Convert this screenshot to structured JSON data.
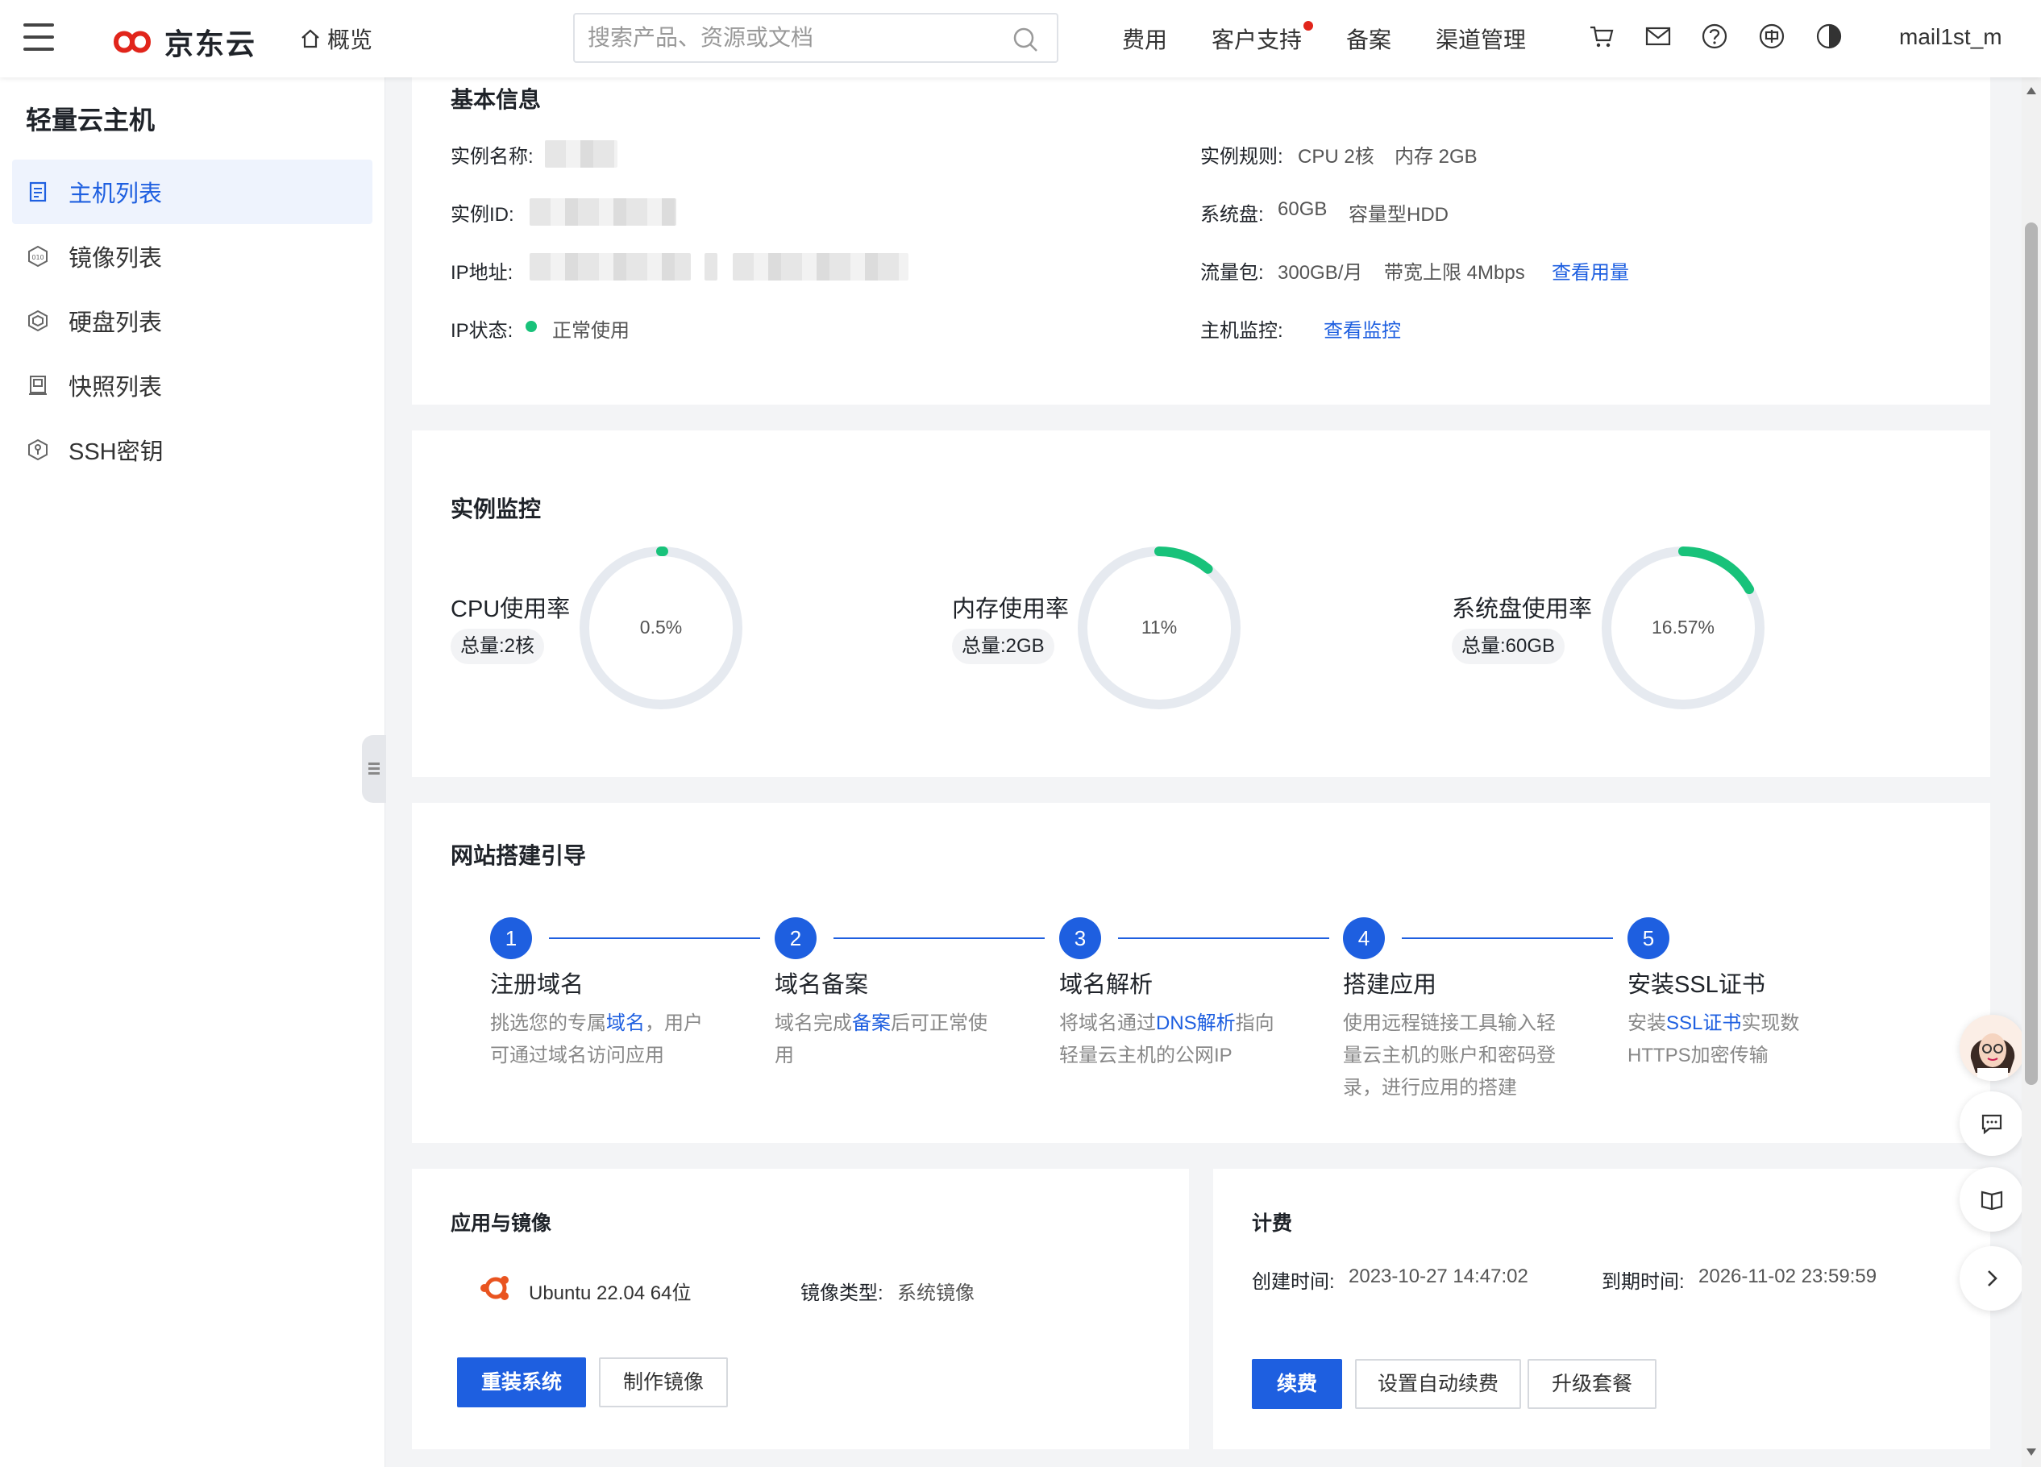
{
  "header": {
    "logo_text": "京东云",
    "overview": "概览",
    "search_placeholder": "搜索产品、资源或文档",
    "nav": [
      "费用",
      "客户支持",
      "备案",
      "渠道管理"
    ],
    "user": "mail1st_m"
  },
  "sidebar": {
    "title": "轻量云主机",
    "items": [
      {
        "label": "主机列表",
        "icon": "host-list-icon",
        "active": true
      },
      {
        "label": "镜像列表",
        "icon": "image-icon"
      },
      {
        "label": "硬盘列表",
        "icon": "disk-icon"
      },
      {
        "label": "快照列表",
        "icon": "snapshot-icon"
      },
      {
        "label": "SSH密钥",
        "icon": "key-icon"
      }
    ]
  },
  "basic_info": {
    "title": "基本信息",
    "instance_name_label": "实例名称:",
    "instance_id_label": "实例ID:",
    "ip_label": "IP地址:",
    "ip_status_label": "IP状态:",
    "ip_status_value": "正常使用",
    "spec_label": "实例规则:",
    "spec_cpu": "CPU 2核",
    "spec_mem": "内存 2GB",
    "sysdisk_label": "系统盘:",
    "sysdisk_size": "60GB",
    "sysdisk_type": "容量型HDD",
    "traffic_label": "流量包:",
    "traffic_value": "300GB/月",
    "bandwidth": "带宽上限 4Mbps",
    "traffic_link": "查看用量",
    "monitor_label": "主机监控:",
    "monitor_link": "查看监控"
  },
  "monitoring": {
    "title": "实例监控",
    "gauges": [
      {
        "label": "CPU使用率",
        "total": "总量:2核",
        "percent_text": "0.5%",
        "percent": 0.5
      },
      {
        "label": "内存使用率",
        "total": "总量:2GB",
        "percent_text": "11%",
        "percent": 11
      },
      {
        "label": "系统盘使用率",
        "total": "总量:60GB",
        "percent_text": "16.57%",
        "percent": 16.57
      }
    ],
    "colors": {
      "track": "#e6eaf0",
      "fill": "#18c27a"
    }
  },
  "guide": {
    "title": "网站搭建引导",
    "steps": [
      {
        "num": "1",
        "title": "注册域名",
        "desc_pre": "挑选您的专属",
        "desc_hl": "域名",
        "desc_post": "，用户可通过域名访问应用"
      },
      {
        "num": "2",
        "title": "域名备案",
        "desc_pre": "域名完成",
        "desc_hl": "备案",
        "desc_post": "后可正常使用"
      },
      {
        "num": "3",
        "title": "域名解析",
        "desc_pre": "将域名通过",
        "desc_hl": "DNS解析",
        "desc_post": "指向轻量云主机的公网IP"
      },
      {
        "num": "4",
        "title": "搭建应用",
        "desc_pre": "使用远程链接工具输入轻量云主机的账户和密码登录，进行应用的搭建",
        "desc_hl": "",
        "desc_post": ""
      },
      {
        "num": "5",
        "title": "安装SSL证书",
        "desc_pre": "安装",
        "desc_hl": "SSL证书",
        "desc_post": "实现数HTTPS加密传输"
      }
    ]
  },
  "app_image": {
    "title": "应用与镜像",
    "os": "Ubuntu 22.04 64位",
    "image_type_label": "镜像类型:",
    "image_type_value": "系统镜像",
    "btn_reinstall": "重装系统",
    "btn_make_image": "制作镜像"
  },
  "billing": {
    "title": "计费",
    "created_label": "创建时间:",
    "created_value": "2023-10-27 14:47:02",
    "expire_label": "到期时间:",
    "expire_value": "2026-11-02 23:59:59",
    "btn_renew": "续费",
    "btn_auto_renew": "设置自动续费",
    "btn_upgrade": "升级套餐"
  },
  "accent_color": "#1e5fe0"
}
